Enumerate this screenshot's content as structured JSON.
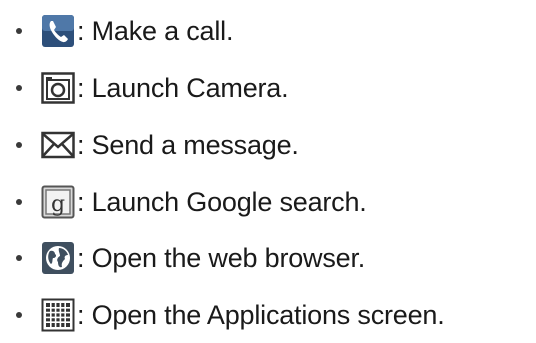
{
  "items": [
    {
      "icon": "phone-icon",
      "text": ": Make a call."
    },
    {
      "icon": "camera-icon",
      "text": ": Launch Camera."
    },
    {
      "icon": "envelope-icon",
      "text": ": Send a message."
    },
    {
      "icon": "google-search-icon",
      "text": ": Launch Google search."
    },
    {
      "icon": "globe-icon",
      "text": ": Open the web browser."
    },
    {
      "icon": "grid-icon",
      "text": ": Open the Applications screen."
    }
  ]
}
